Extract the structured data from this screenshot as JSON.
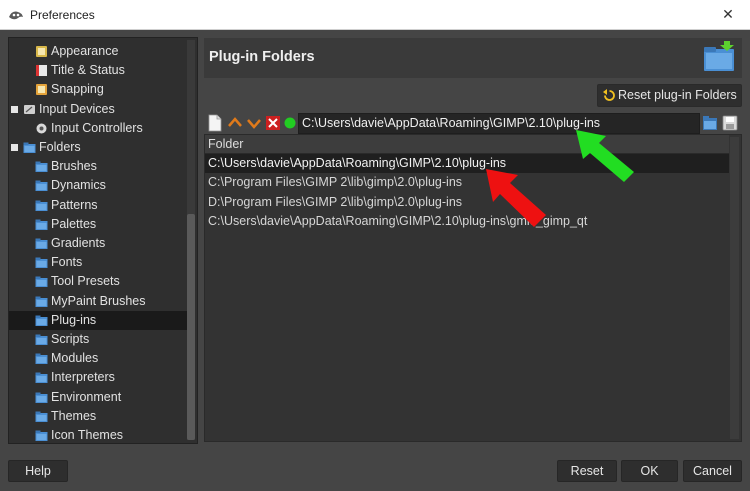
{
  "window": {
    "title": "Preferences",
    "close_label": "✕"
  },
  "sidebar": {
    "items": [
      {
        "label": "Appearance",
        "icon": "appearance-icon",
        "level": 1
      },
      {
        "label": "Title & Status",
        "icon": "title-status-icon",
        "level": 1
      },
      {
        "label": "Snapping",
        "icon": "snapping-icon",
        "level": 1
      },
      {
        "label": "Input Devices",
        "icon": "input-devices-icon",
        "level": 0,
        "expanded": true
      },
      {
        "label": "Input Controllers",
        "icon": "input-controllers-icon",
        "level": 1
      },
      {
        "label": "Folders",
        "icon": "folders-icon",
        "level": 0,
        "expanded": true
      },
      {
        "label": "Brushes",
        "icon": "folder-icon",
        "level": 1
      },
      {
        "label": "Dynamics",
        "icon": "folder-icon",
        "level": 1
      },
      {
        "label": "Patterns",
        "icon": "folder-icon",
        "level": 1
      },
      {
        "label": "Palettes",
        "icon": "folder-icon",
        "level": 1
      },
      {
        "label": "Gradients",
        "icon": "folder-icon",
        "level": 1
      },
      {
        "label": "Fonts",
        "icon": "folder-icon",
        "level": 1
      },
      {
        "label": "Tool Presets",
        "icon": "folder-icon",
        "level": 1
      },
      {
        "label": "MyPaint Brushes",
        "icon": "folder-icon",
        "level": 1
      },
      {
        "label": "Plug-ins",
        "icon": "folder-icon",
        "level": 1,
        "selected": true
      },
      {
        "label": "Scripts",
        "icon": "folder-icon",
        "level": 1
      },
      {
        "label": "Modules",
        "icon": "folder-icon",
        "level": 1
      },
      {
        "label": "Interpreters",
        "icon": "folder-icon",
        "level": 1
      },
      {
        "label": "Environment",
        "icon": "folder-icon",
        "level": 1
      },
      {
        "label": "Themes",
        "icon": "folder-icon",
        "level": 1
      },
      {
        "label": "Icon Themes",
        "icon": "folder-icon",
        "level": 1
      }
    ]
  },
  "panel": {
    "title": "Plug-in Folders",
    "reset_label": "Reset plug-in Folders",
    "path_value": "C:\\Users\\davie\\AppData\\Roaming\\GIMP\\2.10\\plug-ins",
    "column_header": "Folder",
    "folders": [
      {
        "path": "C:\\Users\\davie\\AppData\\Roaming\\GIMP\\2.10\\plug-ins",
        "selected": true
      },
      {
        "path": "C:\\Program Files\\GIMP 2\\lib\\gimp\\2.0\\plug-ins",
        "selected": false
      },
      {
        "path": "D:\\Program Files\\GIMP 2\\lib\\gimp\\2.0\\plug-ins",
        "selected": false
      },
      {
        "path": "C:\\Users\\davie\\AppData\\Roaming\\GIMP\\2.10\\plug-ins\\gmic_gimp_qt",
        "selected": false
      }
    ]
  },
  "buttons": {
    "help": "Help",
    "reset": "Reset",
    "ok": "OK",
    "cancel": "Cancel"
  },
  "colors": {
    "accent_green": "#22dd22",
    "accent_red": "#ee1111",
    "folder_blue": "#4a8fd4"
  }
}
